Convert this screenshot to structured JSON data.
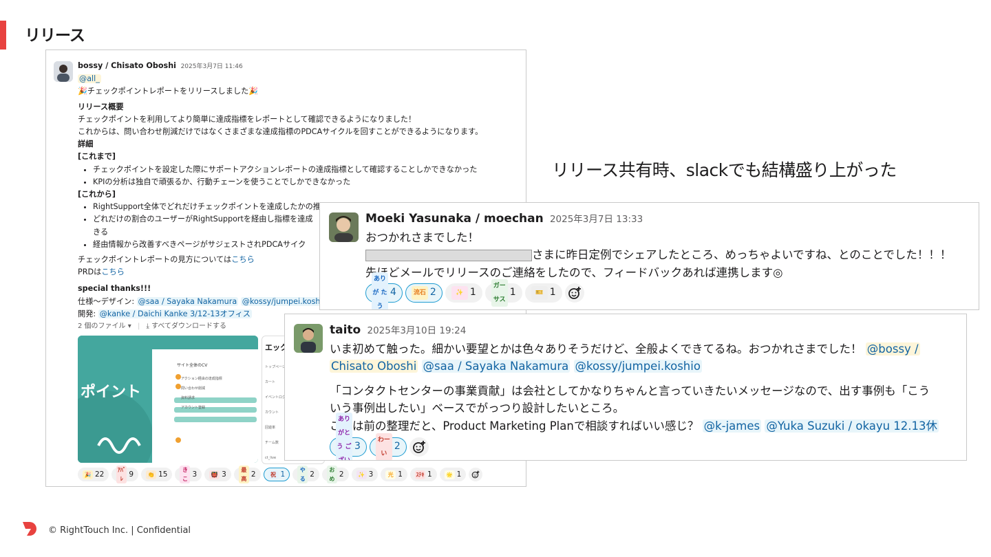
{
  "slide": {
    "title": "リリース",
    "caption": "リリース共有時、slackでも結構盛り上がった",
    "accent_color": "#e8423f",
    "footer": "© RightTouch Inc.  |  Confidential"
  },
  "post1": {
    "author": "bossy / Chisato Oboshi",
    "time": "2025年3月7日 11:46",
    "mention_all": "@all_",
    "headline": "🎉チェックポイントレポートをリリースしました🎉",
    "overview_heading": "リリース概要",
    "overview_1": "チェックポイントを利用してより簡単に達成指標をレポートとして確認できるようになりました！",
    "overview_2": "これからは、問い合わせ削減だけではなくさまざまな達成指標のPDCAサイクルを回すことができるようになります。",
    "details_heading": "詳細",
    "before_heading": "[これまで]",
    "before_1": "チェックポイントを設定した際にサポートアクションレポートの達成指標として確認することしかできなかった",
    "before_2": "KPIの分析は独自で頑張るか、行動チェーンを使うことでしかできなかった",
    "after_heading": "[これから]",
    "after_1": "RightSupport全体でどれだけチェックポイントを達成したかの推移が確認できる",
    "after_2": "どれだけの割合のユーザーがRightSupportを経由し指標を達成",
    "after_2b": "きる",
    "after_3": "経由情報から改善すべきページがサジェストされPDCAサイク",
    "guide_text": "チェックポイントレポートの見方については",
    "guide_link": "こちら",
    "prd_text": "PRDは",
    "prd_link": "こちら",
    "thanks_heading": "special thanks!!!",
    "design_label": "仕様〜デザイン:",
    "design_mention_1": "@saa / Sayaka Nakamura",
    "design_mention_2": "@kossy/jumpei.koshio",
    "dev_label": "開発:",
    "dev_mention": "@kanke / Daichi Kanke 3/12-13オフィス",
    "files_label": "2 個のファイル ▾",
    "download_label": "⤓ すべてダウンロードする",
    "thumb1_text": "ポイント",
    "thumb1_panel_title": "サイト全体のCV",
    "thumb1_rows": [
      "アクション経由の達成指標",
      "問い合わせ削減",
      "資料請求",
      "アカウント登録"
    ],
    "thumb2_title": "エックポ",
    "thumb2_rows": [
      "トップページ",
      "カート",
      "イベントログイン",
      "カウント",
      "回遊率",
      "チーム数",
      "ct_live"
    ],
    "reactions": [
      {
        "emo": "🎉",
        "count": "22",
        "active": false,
        "bg": "#fff3c4",
        "fg": "#c0392b"
      },
      {
        "emo": "ｱﾊﾟﾚ",
        "count": "9",
        "active": false,
        "bg": "#fde2e2",
        "fg": "#c0392b"
      },
      {
        "emo": "👏",
        "count": "15",
        "active": false,
        "bg": "#fdebd0",
        "fg": "#b9770e"
      },
      {
        "emo": "きこ",
        "count": "3",
        "active": false,
        "bg": "#fde2f0",
        "fg": "#c2185b"
      },
      {
        "emo": "👹",
        "count": "3",
        "active": false,
        "bg": "#fde2e2",
        "fg": "#c0392b"
      },
      {
        "emo": "最高",
        "count": "2",
        "active": false,
        "bg": "#fff3c4",
        "fg": "#c0392b"
      },
      {
        "emo": "祝",
        "count": "1",
        "active": true,
        "bg": "#e3f2fd",
        "fg": "#c0392b"
      },
      {
        "emo": "やる",
        "count": "2",
        "active": false,
        "bg": "#e8f5e9",
        "fg": "#1565c0"
      },
      {
        "emo": "おめ",
        "count": "2",
        "active": false,
        "bg": "#e8f5e9",
        "fg": "#2e7d32"
      },
      {
        "emo": "✨",
        "count": "3",
        "active": false,
        "bg": "#f3e5f5",
        "fg": "#8e24aa"
      },
      {
        "emo": "光",
        "count": "1",
        "active": false,
        "bg": "#fffde7",
        "fg": "#f9a825"
      },
      {
        "emo": "ｽﾃｷ",
        "count": "1",
        "active": false,
        "bg": "#fde2e2",
        "fg": "#c0392b"
      },
      {
        "emo": "🌟",
        "count": "1",
        "active": false,
        "bg": "#fffde7",
        "fg": "#f9a825"
      }
    ]
  },
  "post2": {
    "author": "Moeki Yasunaka / moechan",
    "time": "2025年3月7日 13:33",
    "line1": "おつかれさまでした！",
    "line2": "さまに昨日定例でシェアしたところ、めっちゃよいですね、とのことでした！！！",
    "line3": "先ほどメールでリリースのご連絡をしたので、フィードバックあれば連携します◎",
    "reactions": [
      {
        "emo": "ありが たう",
        "count": "4",
        "active": true,
        "bg": "#e3f2fd",
        "fg": "#1565c0"
      },
      {
        "emo": "流石",
        "count": "2",
        "active": true,
        "bg": "#fff3c4",
        "fg": "#e67e22"
      },
      {
        "emo": "✨",
        "count": "1",
        "active": false,
        "bg": "#fde2f0",
        "fg": "#c2185b"
      },
      {
        "emo": "ガー サス",
        "count": "1",
        "active": false,
        "bg": "#e8f5e9",
        "fg": "#2e7d32"
      },
      {
        "emo": "🎫",
        "count": "1",
        "active": false,
        "bg": "#eeeeee",
        "fg": "#333333"
      }
    ]
  },
  "post3": {
    "author": "taito",
    "time": "2025年3月10日 19:24",
    "line1": "いま初めて触った。細かい要望とかは色々ありそうだけど、全般よくできてるね。おつかれさまでした！",
    "mention_1a": "@bossy /",
    "mention_1b": "Chisato Oboshi",
    "mention_2": "@saa / Sayaka Nakamura",
    "mention_3": "@kossy/jumpei.koshio",
    "line2": "「コンタクトセンターの事業貢献」は会社としてかなりちゃんと言っていきたいメッセージなので、出す事例も「こう",
    "line3": "いう事例出したい」ベースでがっつり設計したいところ。",
    "line4": "これは前の整理だと、Product Marketing Planで相談すればいい感じ？",
    "mention_4": "@k-james",
    "mention_5": "@Yuka Suzuki / okayu 12.13休",
    "reactions": [
      {
        "emo": "ありがとう ございます",
        "count": "3",
        "active": true,
        "bg": "#e3f2fd",
        "fg": "#8e24aa"
      },
      {
        "emo": "わーい",
        "count": "2",
        "active": true,
        "bg": "#fde2e2",
        "fg": "#c0392b"
      }
    ]
  }
}
